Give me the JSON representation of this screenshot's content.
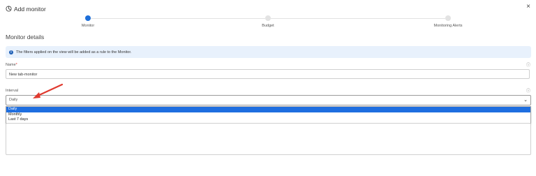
{
  "header": {
    "title": "Add monitor",
    "close": "×"
  },
  "stepper": {
    "steps": [
      {
        "label": "Monitor"
      },
      {
        "label": "Budget"
      },
      {
        "label": "Monitoring Alerts"
      }
    ]
  },
  "section": {
    "title": "Monitor details"
  },
  "info": {
    "text": "The filters applied on the view will be added as a rule to the Monitor."
  },
  "fields": {
    "name": {
      "label": "Name",
      "required": "*",
      "value": "New tab-monitor"
    },
    "interval": {
      "label": "Interval",
      "value": "Daily",
      "options": [
        "Daily",
        "Monthly",
        "Last 7 days"
      ]
    }
  },
  "colors": {
    "accent": "#1e6fd9",
    "annotation_arrow": "#e03a2f"
  }
}
